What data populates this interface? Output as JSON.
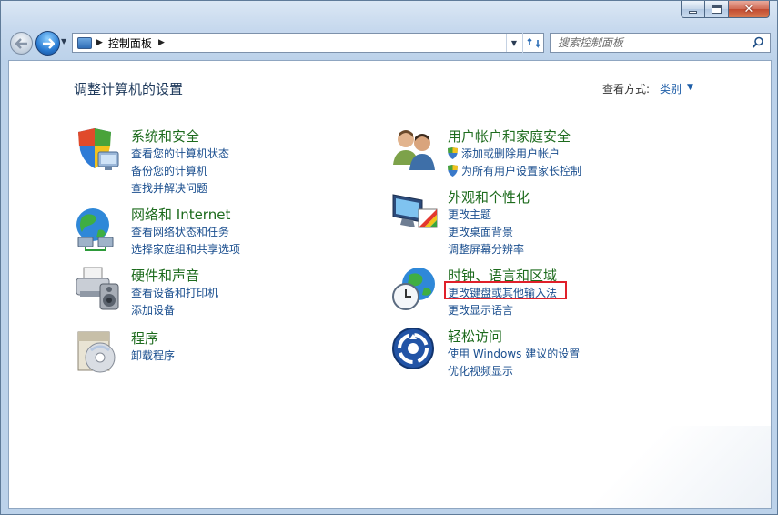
{
  "window": {
    "colors": {
      "accent": "#1e5ea8",
      "category_title": "#1d6b1d",
      "link": "#1b4f8f",
      "highlight": "#e0202a"
    },
    "caption": {
      "minimize_icon": "minimize-icon",
      "maximize_icon": "maximize-icon",
      "close_icon": "close-icon"
    }
  },
  "nav": {
    "breadcrumb": "控制面板",
    "search_placeholder": "搜索控制面板"
  },
  "header": {
    "title": "调整计算机的设置",
    "view_by_label": "查看方式:",
    "view_by_value": "类别"
  },
  "categories": [
    {
      "title": "系统和安全",
      "icon": "shield-pc-icon",
      "links": [
        "查看您的计算机状态",
        "备份您的计算机",
        "查找并解决问题"
      ]
    },
    {
      "title": "网络和 Internet",
      "icon": "network-globe-icon",
      "links": [
        "查看网络状态和任务",
        "选择家庭组和共享选项"
      ]
    },
    {
      "title": "硬件和声音",
      "icon": "printer-speaker-icon",
      "links": [
        "查看设备和打印机",
        "添加设备"
      ]
    },
    {
      "title": "程序",
      "icon": "programs-disc-icon",
      "links": [
        "卸载程序"
      ]
    },
    {
      "title": "用户帐户和家庭安全",
      "icon": "users-icon",
      "links": [
        "添加或删除用户帐户",
        "为所有用户设置家长控制"
      ]
    },
    {
      "title": "外观和个性化",
      "icon": "monitor-palette-icon",
      "links": [
        "更改主题",
        "更改桌面背景",
        "调整屏幕分辨率"
      ]
    },
    {
      "title": "时钟、语言和区域",
      "icon": "clock-globe-icon",
      "links": [
        "更改键盘或其他输入法",
        "更改显示语言"
      ]
    },
    {
      "title": "轻松访问",
      "icon": "ease-of-access-icon",
      "links": [
        "使用 Windows 建议的设置",
        "优化视频显示"
      ]
    }
  ]
}
